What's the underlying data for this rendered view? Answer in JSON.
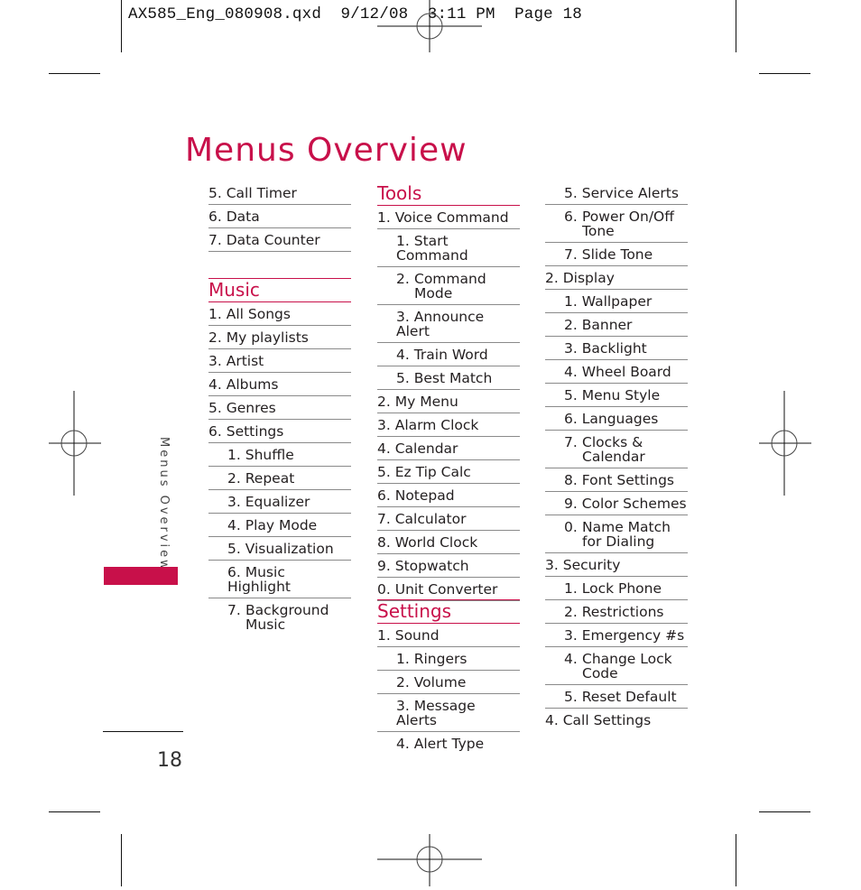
{
  "slug_line": "AX585_Eng_080908.qxd  9/12/08  3:11 PM  Page 18",
  "title": "Menus Overview",
  "side_label": "Menus Overview",
  "page_number": "18",
  "accent_color": "#c8104a",
  "column1": {
    "continued_items": [
      {
        "num": "5.",
        "label": "Call Timer"
      },
      {
        "num": "6.",
        "label": "Data"
      },
      {
        "num": "7.",
        "label": "Data Counter"
      }
    ],
    "music": {
      "heading": "Music",
      "items": [
        {
          "num": "1.",
          "label": "All Songs",
          "level": 1
        },
        {
          "num": "2.",
          "label": "My playlists",
          "level": 1
        },
        {
          "num": "3.",
          "label": "Artist",
          "level": 1
        },
        {
          "num": "4.",
          "label": "Albums",
          "level": 1
        },
        {
          "num": "5.",
          "label": "Genres",
          "level": 1
        },
        {
          "num": "6.",
          "label": "Settings",
          "level": 1
        },
        {
          "num": "1.",
          "label": "Shuffle",
          "level": 2
        },
        {
          "num": "2.",
          "label": "Repeat",
          "level": 2
        },
        {
          "num": "3.",
          "label": "Equalizer",
          "level": 2
        },
        {
          "num": "4.",
          "label": "Play Mode",
          "level": 2
        },
        {
          "num": "5.",
          "label": "Visualization",
          "level": 2
        },
        {
          "num": "6.",
          "label": "Music Highlight",
          "level": 2
        },
        {
          "num": "7.",
          "label": "Background Music",
          "level": 2
        }
      ]
    }
  },
  "column2": {
    "tools": {
      "heading": "Tools",
      "items": [
        {
          "num": "1.",
          "label": "Voice Command",
          "level": 1
        },
        {
          "num": "1.",
          "label": "Start Command",
          "level": 2
        },
        {
          "num": "2.",
          "label": "Command Mode",
          "level": 2
        },
        {
          "num": "3.",
          "label": "Announce Alert",
          "level": 2
        },
        {
          "num": "4.",
          "label": "Train Word",
          "level": 2
        },
        {
          "num": "5.",
          "label": "Best Match",
          "level": 2
        },
        {
          "num": "2.",
          "label": "My Menu",
          "level": 1
        },
        {
          "num": "3.",
          "label": "Alarm Clock",
          "level": 1
        },
        {
          "num": "4.",
          "label": "Calendar",
          "level": 1
        },
        {
          "num": "5.",
          "label": "Ez Tip Calc",
          "level": 1
        },
        {
          "num": "6.",
          "label": "Notepad",
          "level": 1
        },
        {
          "num": "7.",
          "label": "Calculator",
          "level": 1
        },
        {
          "num": "8.",
          "label": "World Clock",
          "level": 1
        },
        {
          "num": "9.",
          "label": "Stopwatch",
          "level": 1
        },
        {
          "num": "0.",
          "label": "Unit Converter",
          "level": 1
        }
      ]
    },
    "settings": {
      "heading": "Settings",
      "items": [
        {
          "num": "1.",
          "label": "Sound",
          "level": 1
        },
        {
          "num": "1.",
          "label": "Ringers",
          "level": 2
        },
        {
          "num": "2.",
          "label": "Volume",
          "level": 2
        },
        {
          "num": "3.",
          "label": "Message Alerts",
          "level": 2
        },
        {
          "num": "4.",
          "label": "Alert Type",
          "level": 2
        }
      ]
    }
  },
  "column3": {
    "items": [
      {
        "num": "5.",
        "label": "Service Alerts",
        "level": 2
      },
      {
        "num": "6.",
        "label": "Power On/Off Tone",
        "level": 2
      },
      {
        "num": "7.",
        "label": "Slide Tone",
        "level": 2
      },
      {
        "num": "2.",
        "label": "Display",
        "level": 1
      },
      {
        "num": "1.",
        "label": "Wallpaper",
        "level": 2
      },
      {
        "num": "2.",
        "label": "Banner",
        "level": 2
      },
      {
        "num": "3.",
        "label": "Backlight",
        "level": 2
      },
      {
        "num": "4.",
        "label": "Wheel Board",
        "level": 2
      },
      {
        "num": "5.",
        "label": "Menu Style",
        "level": 2
      },
      {
        "num": "6.",
        "label": "Languages",
        "level": 2
      },
      {
        "num": "7.",
        "label": "Clocks & Calendar",
        "level": 2
      },
      {
        "num": "8.",
        "label": "Font Settings",
        "level": 2
      },
      {
        "num": "9.",
        "label": "Color Schemes",
        "level": 2
      },
      {
        "num": "0.",
        "label": "Name Match for Dialing",
        "level": 2
      },
      {
        "num": "3.",
        "label": "Security",
        "level": 1
      },
      {
        "num": "1.",
        "label": "Lock Phone",
        "level": 2
      },
      {
        "num": "2.",
        "label": "Restrictions",
        "level": 2
      },
      {
        "num": "3.",
        "label": "Emergency #s",
        "level": 2
      },
      {
        "num": "4.",
        "label": "Change Lock Code",
        "level": 2
      },
      {
        "num": "5.",
        "label": "Reset Default",
        "level": 2
      },
      {
        "num": "4.",
        "label": "Call Settings",
        "level": 1
      }
    ]
  }
}
